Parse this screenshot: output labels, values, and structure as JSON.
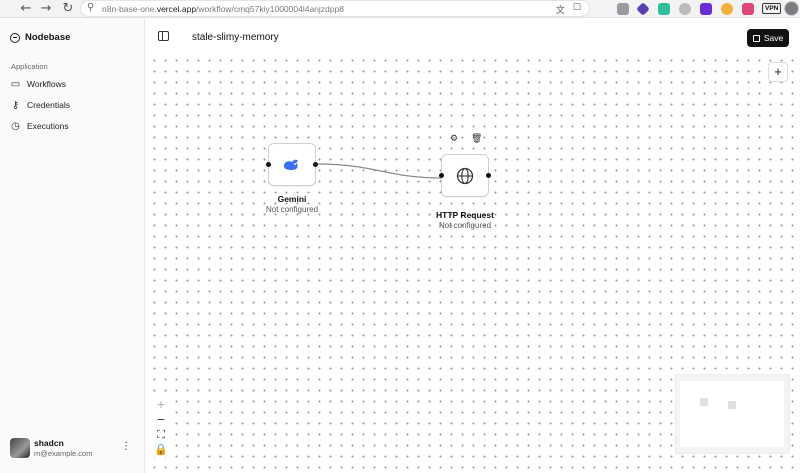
{
  "browser": {
    "url_prefix": "n8n-base-one.",
    "url_domain": "vercel.app",
    "url_path": "/workflow/cmq57kiy1000004l4anjzdpp8",
    "vpn_badge": "VPN",
    "icons": [
      "back-icon",
      "forward-icon",
      "reload-icon",
      "site-info-icon",
      "translate-icon",
      "bookmark-icon"
    ]
  },
  "sidebar": {
    "brand": "Nodebase",
    "group_label": "Application",
    "items": [
      {
        "label": "Workflows",
        "icon": "folder-icon"
      },
      {
        "label": "Credentials",
        "icon": "key-icon"
      },
      {
        "label": "Executions",
        "icon": "clock-icon"
      }
    ],
    "user": {
      "name": "shadcn",
      "email": "m@example.com"
    }
  },
  "header": {
    "title": "stale-slimy-memory",
    "save_label": "Save"
  },
  "canvas": {
    "nodes": [
      {
        "title": "Gemini",
        "subtitle": "Not configured",
        "icon": "gemini-icon"
      },
      {
        "title": "HTTP Request",
        "subtitle": "Not configured",
        "icon": "globe-icon"
      }
    ]
  },
  "colors": {
    "accent": "#111111",
    "gemini": "#3b6df0"
  }
}
